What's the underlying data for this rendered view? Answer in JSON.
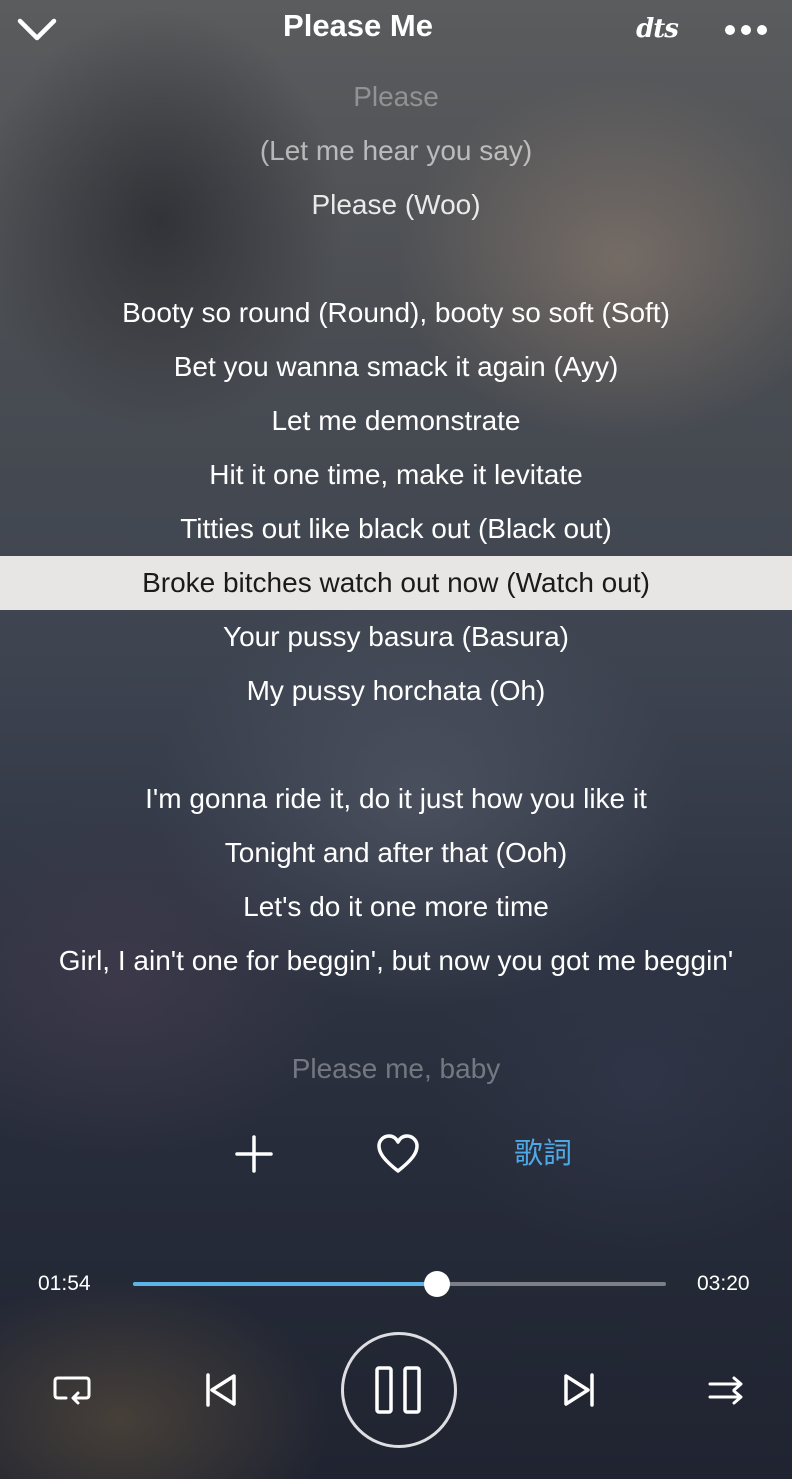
{
  "header": {
    "title": "Please Me",
    "audio_badge": "dts"
  },
  "lyrics": [
    {
      "text": "Please",
      "state": "dim1"
    },
    {
      "text": "(Let me hear you say)",
      "state": "dim2"
    },
    {
      "text": "Please (Woo)",
      "state": "dim3"
    },
    {
      "text": "",
      "state": "blank"
    },
    {
      "text": "Booty so round (Round), booty so soft (Soft)",
      "state": "normal"
    },
    {
      "text": "Bet you wanna smack it again (Ayy)",
      "state": "normal"
    },
    {
      "text": "Let me demonstrate",
      "state": "normal"
    },
    {
      "text": "Hit it one time, make it levitate",
      "state": "normal"
    },
    {
      "text": "Titties out like black out (Black out)",
      "state": "normal"
    },
    {
      "text": "Broke bitches watch out now (Watch out)",
      "state": "current"
    },
    {
      "text": "Your pussy basura (Basura)",
      "state": "normal"
    },
    {
      "text": "My pussy horchata (Oh)",
      "state": "normal"
    },
    {
      "text": "",
      "state": "blank"
    },
    {
      "text": "I'm gonna ride it, do it just how you like it",
      "state": "normal"
    },
    {
      "text": "Tonight and after that (Ooh)",
      "state": "normal"
    },
    {
      "text": "Let's do it one more time",
      "state": "normal"
    },
    {
      "text": "Girl, I ain't one for beggin', but now you got me beggin'",
      "state": "normal"
    },
    {
      "text": "",
      "state": "blank"
    },
    {
      "text": "Please me, baby",
      "state": "fade"
    }
  ],
  "actions": {
    "add_icon": "plus-icon",
    "favorite_icon": "heart-outline-icon",
    "lyrics_label": "歌詞"
  },
  "playback": {
    "elapsed": "01:54",
    "duration": "03:20",
    "progress_fraction": 0.57,
    "accent_color": "#5cb3ea"
  },
  "controls": {
    "repeat_icon": "repeat-loop-icon",
    "previous_icon": "skip-previous-icon",
    "play_state_icon": "pause-icon",
    "next_icon": "skip-next-icon",
    "shuffle_icon": "shuffle-icon"
  }
}
